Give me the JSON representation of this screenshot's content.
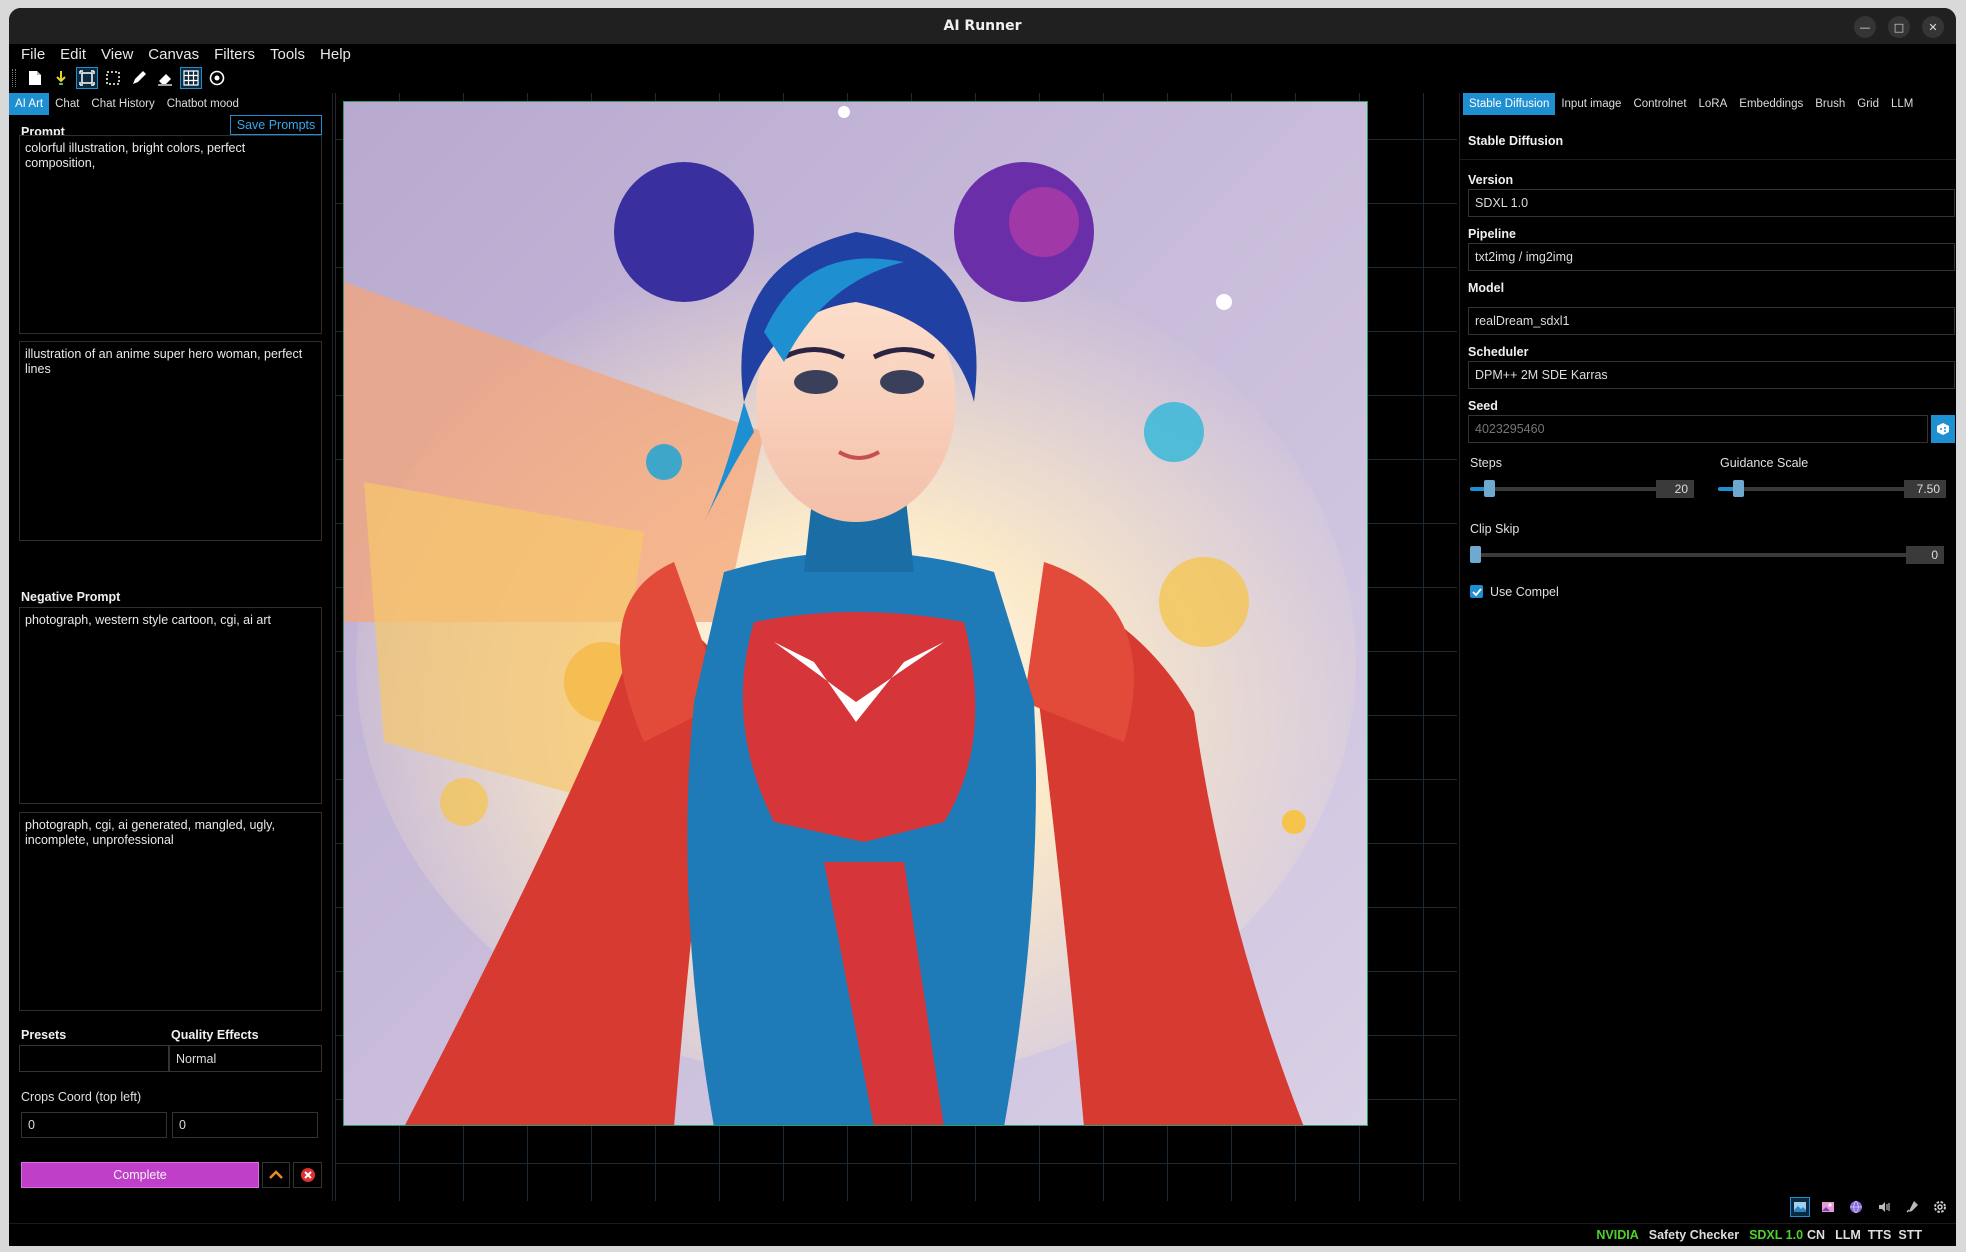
{
  "window": {
    "title": "AI Runner"
  },
  "menu": [
    "File",
    "Edit",
    "View",
    "Canvas",
    "Filters",
    "Tools",
    "Help"
  ],
  "toolbar_icons": [
    "new-document-icon",
    "download-icon",
    "active-grid-area-icon",
    "selection-icon",
    "pencil-icon",
    "eraser-icon",
    "grid-icon",
    "circle-target-icon"
  ],
  "left": {
    "tabs": [
      "AI Art",
      "Chat",
      "Chat History",
      "Chatbot mood"
    ],
    "prompt_label": "Prompt",
    "save_prompts": "Save Prompts",
    "prompt_text": "colorful illustration, bright colors, perfect composition,",
    "prompt_secondary": "illustration of an anime super hero woman, perfect lines",
    "negative_label": "Negative Prompt",
    "negative_text": "photograph, western style cartoon, cgi, ai art",
    "negative_secondary": "photograph, cgi, ai generated, mangled, ugly, incomplete, unprofessional",
    "presets_label": "Presets",
    "presets_value": "",
    "quality_label": "Quality Effects",
    "quality_value": "Normal",
    "crops_label": "Crops Coord (top left)",
    "crop_x": "0",
    "crop_y": "0",
    "generate_label": "Complete"
  },
  "right": {
    "tabs": [
      "Stable Diffusion",
      "Input image",
      "Controlnet",
      "LoRA",
      "Embeddings",
      "Brush",
      "Grid",
      "LLM"
    ],
    "section_title": "Stable Diffusion",
    "version_label": "Version",
    "version_value": "SDXL 1.0",
    "pipeline_label": "Pipeline",
    "pipeline_value": "txt2img / img2img",
    "model_label": "Model",
    "model_value": "realDream_sdxl1",
    "scheduler_label": "Scheduler",
    "scheduler_value": "DPM++ 2M SDE Karras",
    "seed_label": "Seed",
    "seed_placeholder": "4023295460",
    "steps_label": "Steps",
    "steps_value": "20",
    "steps_fraction": 0.1,
    "guidance_label": "Guidance Scale",
    "guidance_value": "7.50",
    "guidance_fraction": 0.1,
    "clip_label": "Clip Skip",
    "clip_value": "0",
    "clip_fraction": 0.0,
    "use_compel_label": "Use Compel",
    "use_compel_checked": true
  },
  "status": {
    "gpu": "NVIDIA",
    "safety": "Safety Checker",
    "version": "SDXL 1.0",
    "cn": "CN",
    "llm": "LLM",
    "tts": "TTS",
    "stt": "STT"
  },
  "colors": {
    "accent": "#1e8fd1",
    "generate_button": "#c03fc9",
    "status_green": "#4fd12b",
    "status_gray": "#dddddd"
  }
}
